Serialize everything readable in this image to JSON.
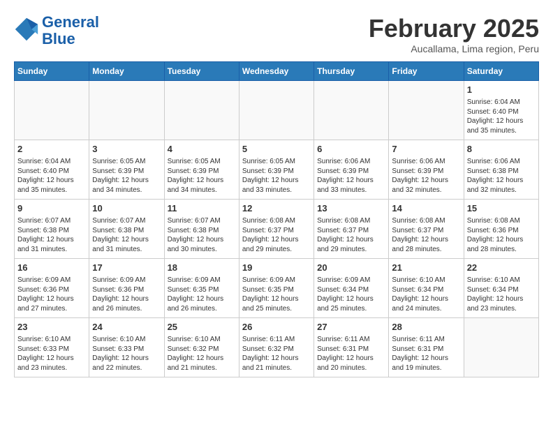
{
  "logo": {
    "line1": "General",
    "line2": "Blue"
  },
  "title": "February 2025",
  "subtitle": "Aucallama, Lima region, Peru",
  "days_header": [
    "Sunday",
    "Monday",
    "Tuesday",
    "Wednesday",
    "Thursday",
    "Friday",
    "Saturday"
  ],
  "weeks": [
    [
      {
        "day": "",
        "info": ""
      },
      {
        "day": "",
        "info": ""
      },
      {
        "day": "",
        "info": ""
      },
      {
        "day": "",
        "info": ""
      },
      {
        "day": "",
        "info": ""
      },
      {
        "day": "",
        "info": ""
      },
      {
        "day": "1",
        "info": "Sunrise: 6:04 AM\nSunset: 6:40 PM\nDaylight: 12 hours\nand 35 minutes."
      }
    ],
    [
      {
        "day": "2",
        "info": "Sunrise: 6:04 AM\nSunset: 6:40 PM\nDaylight: 12 hours\nand 35 minutes."
      },
      {
        "day": "3",
        "info": "Sunrise: 6:05 AM\nSunset: 6:39 PM\nDaylight: 12 hours\nand 34 minutes."
      },
      {
        "day": "4",
        "info": "Sunrise: 6:05 AM\nSunset: 6:39 PM\nDaylight: 12 hours\nand 34 minutes."
      },
      {
        "day": "5",
        "info": "Sunrise: 6:05 AM\nSunset: 6:39 PM\nDaylight: 12 hours\nand 33 minutes."
      },
      {
        "day": "6",
        "info": "Sunrise: 6:06 AM\nSunset: 6:39 PM\nDaylight: 12 hours\nand 33 minutes."
      },
      {
        "day": "7",
        "info": "Sunrise: 6:06 AM\nSunset: 6:39 PM\nDaylight: 12 hours\nand 32 minutes."
      },
      {
        "day": "8",
        "info": "Sunrise: 6:06 AM\nSunset: 6:38 PM\nDaylight: 12 hours\nand 32 minutes."
      }
    ],
    [
      {
        "day": "9",
        "info": "Sunrise: 6:07 AM\nSunset: 6:38 PM\nDaylight: 12 hours\nand 31 minutes."
      },
      {
        "day": "10",
        "info": "Sunrise: 6:07 AM\nSunset: 6:38 PM\nDaylight: 12 hours\nand 31 minutes."
      },
      {
        "day": "11",
        "info": "Sunrise: 6:07 AM\nSunset: 6:38 PM\nDaylight: 12 hours\nand 30 minutes."
      },
      {
        "day": "12",
        "info": "Sunrise: 6:08 AM\nSunset: 6:37 PM\nDaylight: 12 hours\nand 29 minutes."
      },
      {
        "day": "13",
        "info": "Sunrise: 6:08 AM\nSunset: 6:37 PM\nDaylight: 12 hours\nand 29 minutes."
      },
      {
        "day": "14",
        "info": "Sunrise: 6:08 AM\nSunset: 6:37 PM\nDaylight: 12 hours\nand 28 minutes."
      },
      {
        "day": "15",
        "info": "Sunrise: 6:08 AM\nSunset: 6:36 PM\nDaylight: 12 hours\nand 28 minutes."
      }
    ],
    [
      {
        "day": "16",
        "info": "Sunrise: 6:09 AM\nSunset: 6:36 PM\nDaylight: 12 hours\nand 27 minutes."
      },
      {
        "day": "17",
        "info": "Sunrise: 6:09 AM\nSunset: 6:36 PM\nDaylight: 12 hours\nand 26 minutes."
      },
      {
        "day": "18",
        "info": "Sunrise: 6:09 AM\nSunset: 6:35 PM\nDaylight: 12 hours\nand 26 minutes."
      },
      {
        "day": "19",
        "info": "Sunrise: 6:09 AM\nSunset: 6:35 PM\nDaylight: 12 hours\nand 25 minutes."
      },
      {
        "day": "20",
        "info": "Sunrise: 6:09 AM\nSunset: 6:34 PM\nDaylight: 12 hours\nand 25 minutes."
      },
      {
        "day": "21",
        "info": "Sunrise: 6:10 AM\nSunset: 6:34 PM\nDaylight: 12 hours\nand 24 minutes."
      },
      {
        "day": "22",
        "info": "Sunrise: 6:10 AM\nSunset: 6:34 PM\nDaylight: 12 hours\nand 23 minutes."
      }
    ],
    [
      {
        "day": "23",
        "info": "Sunrise: 6:10 AM\nSunset: 6:33 PM\nDaylight: 12 hours\nand 23 minutes."
      },
      {
        "day": "24",
        "info": "Sunrise: 6:10 AM\nSunset: 6:33 PM\nDaylight: 12 hours\nand 22 minutes."
      },
      {
        "day": "25",
        "info": "Sunrise: 6:10 AM\nSunset: 6:32 PM\nDaylight: 12 hours\nand 21 minutes."
      },
      {
        "day": "26",
        "info": "Sunrise: 6:11 AM\nSunset: 6:32 PM\nDaylight: 12 hours\nand 21 minutes."
      },
      {
        "day": "27",
        "info": "Sunrise: 6:11 AM\nSunset: 6:31 PM\nDaylight: 12 hours\nand 20 minutes."
      },
      {
        "day": "28",
        "info": "Sunrise: 6:11 AM\nSunset: 6:31 PM\nDaylight: 12 hours\nand 19 minutes."
      },
      {
        "day": "",
        "info": ""
      }
    ]
  ]
}
